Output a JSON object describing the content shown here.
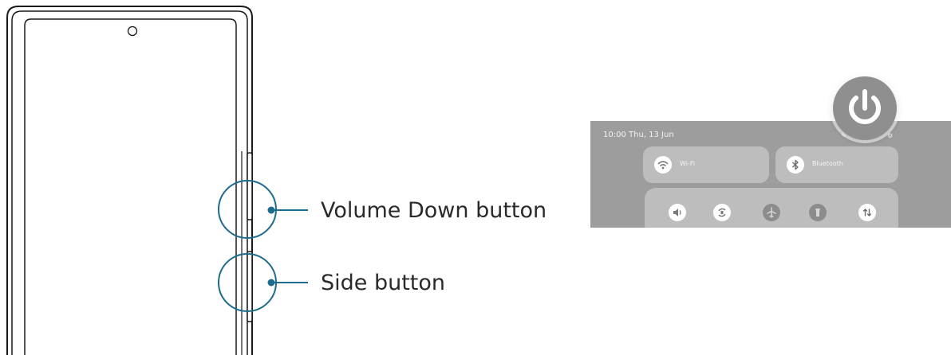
{
  "callouts": {
    "volume_down": "Volume Down button",
    "side": "Side button"
  },
  "quick_panel": {
    "time_date": "10:00  Thu, 13 Jun",
    "tiles": [
      {
        "label": "Wi-Fi",
        "icon": "wifi-icon"
      },
      {
        "label": "Bluetooth",
        "icon": "bluetooth-icon"
      }
    ],
    "quick_settings": [
      {
        "icon": "sound-icon",
        "on": true
      },
      {
        "icon": "auto-rotate-icon",
        "on": true
      },
      {
        "icon": "airplane-mode-icon",
        "on": false
      },
      {
        "icon": "flashlight-icon",
        "on": false
      },
      {
        "icon": "mobile-data-icon",
        "on": true
      }
    ],
    "highlight": "power-icon"
  },
  "colors": {
    "callout": "#1d6b8f",
    "panel": "#9d9d9d",
    "tile": "#bdbdbd"
  }
}
